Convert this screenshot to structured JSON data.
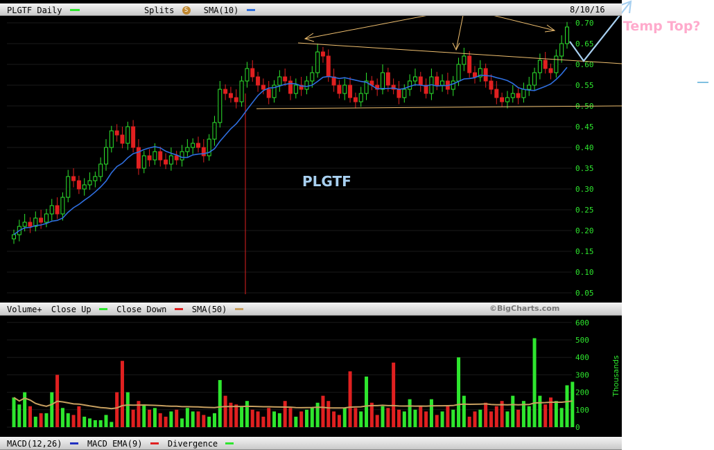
{
  "header": {
    "ticker_label": "PLGTF Daily",
    "splits_label": "Splits",
    "splits_badge": "S",
    "sma_label": "SMA(10)",
    "date": "8/10/16"
  },
  "volume_header": {
    "title": "Volume+",
    "close_up": "Close Up",
    "close_down": "Close Down",
    "sma_label": "SMA(50)",
    "watermark": "©BigCharts.com"
  },
  "macd_header": {
    "macd_label": "MACD(12,26)",
    "ema_label": "MACD EMA(9)",
    "divergence_label": "Divergence"
  },
  "annotations": {
    "chart_label": "PLGTF",
    "temp_top": "Temp Top?"
  },
  "colors": {
    "up": "#2ee62e",
    "down": "#e02020",
    "sma10": "#2f6fe0",
    "sma50": "#c8a060",
    "trendline": "#f0c070",
    "label_blue": "#a8d0f0",
    "temp_top": "#ffaacc"
  },
  "chart_data": [
    {
      "type": "candlestick",
      "title": "PLGTF Daily",
      "ylim": [
        0.0,
        0.72
      ],
      "yticks": [
        "0.70",
        "0.65",
        "0.60",
        "0.55",
        "0.50",
        "0.45",
        "0.40",
        "0.35",
        "0.30",
        "0.25",
        "0.20",
        "0.15",
        "0.10",
        "0.05"
      ],
      "series_names": [
        "SMA(10)"
      ],
      "closes": [
        0.19,
        0.21,
        0.22,
        0.21,
        0.23,
        0.22,
        0.24,
        0.26,
        0.24,
        0.28,
        0.33,
        0.32,
        0.3,
        0.31,
        0.32,
        0.33,
        0.36,
        0.4,
        0.44,
        0.43,
        0.41,
        0.45,
        0.4,
        0.35,
        0.38,
        0.37,
        0.39,
        0.37,
        0.36,
        0.38,
        0.37,
        0.39,
        0.4,
        0.41,
        0.4,
        0.38,
        0.42,
        0.46,
        0.54,
        0.53,
        0.52,
        0.51,
        0.56,
        0.59,
        0.57,
        0.55,
        0.54,
        0.52,
        0.55,
        0.57,
        0.56,
        0.53,
        0.55,
        0.54,
        0.56,
        0.58,
        0.63,
        0.62,
        0.57,
        0.55,
        0.53,
        0.55,
        0.52,
        0.51,
        0.53,
        0.56,
        0.55,
        0.54,
        0.58,
        0.55,
        0.54,
        0.52,
        0.54,
        0.56,
        0.57,
        0.55,
        0.53,
        0.57,
        0.55,
        0.56,
        0.54,
        0.56,
        0.6,
        0.62,
        0.58,
        0.57,
        0.59,
        0.56,
        0.54,
        0.52,
        0.51,
        0.52,
        0.53,
        0.52,
        0.54,
        0.55,
        0.58,
        0.61,
        0.59,
        0.58,
        0.62,
        0.65,
        0.69
      ],
      "volume_thousands": [
        170,
        130,
        200,
        120,
        60,
        80,
        80,
        200,
        300,
        110,
        80,
        70,
        120,
        60,
        50,
        40,
        40,
        70,
        30,
        200,
        380,
        200,
        100,
        150,
        130,
        100,
        110,
        80,
        60,
        90,
        100,
        50,
        110,
        90,
        90,
        70,
        60,
        80,
        270,
        180,
        140,
        130,
        120,
        150,
        100,
        90,
        60,
        110,
        90,
        80,
        150,
        110,
        60,
        90,
        100,
        110,
        140,
        180,
        150,
        90,
        70,
        110,
        320,
        110,
        90,
        290,
        140,
        70,
        120,
        110,
        370,
        100,
        90,
        160,
        100,
        120,
        90,
        160,
        70,
        90,
        120,
        100,
        400,
        180,
        60,
        90,
        100,
        140,
        90,
        120,
        150,
        90,
        180,
        100,
        150,
        120,
        510,
        180,
        130,
        170,
        150,
        110,
        240,
        260
      ],
      "volume_ylim": [
        0,
        600
      ],
      "volume_yticks": [
        "600",
        "500",
        "400",
        "300",
        "200",
        "100",
        "0"
      ],
      "volume_ylabel": "Thousands",
      "volume_series_names": [
        "Close Up",
        "Close Down",
        "SMA(50)"
      ]
    }
  ]
}
